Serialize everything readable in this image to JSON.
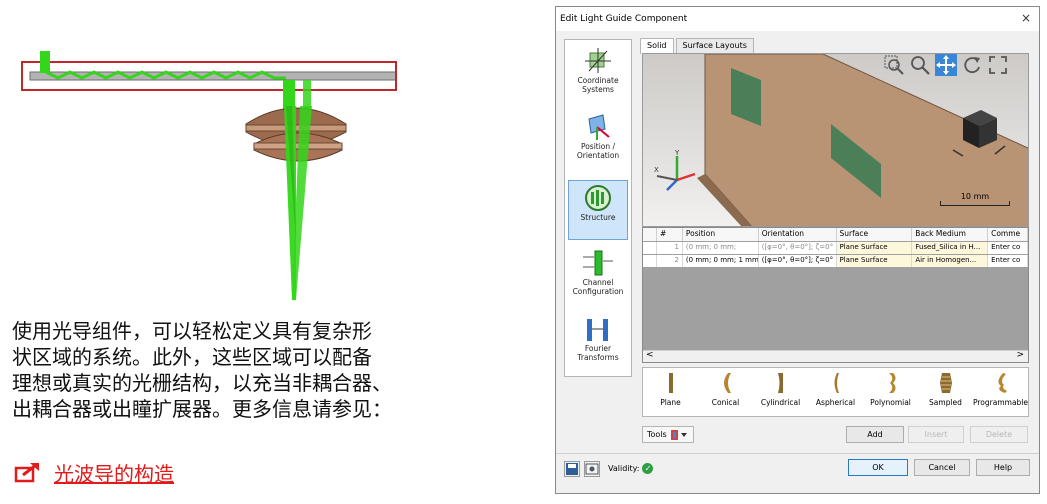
{
  "left_panel": {
    "description_lines": [
      "使用光导组件，可以轻松定义具有复杂形",
      "状区域的系统。此外，这些区域可以配备",
      "理想或真实的光栅结构，以充当非耦合器、",
      "出耦合器或出瞳扩展器。更多信息请参见："
    ],
    "link_text": "光波导的构造",
    "link_icon": "external-link-icon",
    "colors": {
      "beam": "#33d61a",
      "frame": "#c0272d",
      "link": "#e21a1a"
    }
  },
  "dialog": {
    "title": "Edit Light Guide Component",
    "close_glyph": "×",
    "nav": [
      {
        "label": "Coordinate Systems",
        "icon": "coordinate-systems-icon",
        "selected": false
      },
      {
        "label": "Position / Orientation",
        "icon": "position-orientation-icon",
        "selected": false
      },
      {
        "label": "Structure",
        "icon": "structure-icon",
        "selected": true
      },
      {
        "label": "Channel Configuration",
        "icon": "channel-configuration-icon",
        "selected": false
      },
      {
        "label": "Fourier Transforms",
        "icon": "fourier-transforms-icon",
        "selected": false
      }
    ],
    "tabs": [
      {
        "label": "Solid",
        "active": true
      },
      {
        "label": "Surface Layouts",
        "active": false
      }
    ],
    "viewport": {
      "tools": [
        "zoom-window-icon",
        "zoom-icon",
        "pan-icon",
        "rotate-icon",
        "fit-view-icon"
      ],
      "scale_label": "10 mm",
      "axis_labels": {
        "x": "X",
        "y": "Y"
      }
    },
    "table": {
      "headers": [
        "#",
        "Position",
        "Orientation",
        "Surface",
        "Back Medium",
        "Comme"
      ],
      "rows": [
        {
          "n": "1",
          "position": "(0 mm; 0 mm;",
          "orientation": "([φ=0°, θ=0°]; ζ=0°",
          "surface": "Plane Surface",
          "back_medium": "Fused_Silica in H...",
          "comment": "Enter co"
        },
        {
          "n": "2",
          "position": "(0 mm; 0 mm; 1 mm",
          "orientation": "([φ=0°, θ=0°]; ζ=0°",
          "surface": "Plane Surface",
          "back_medium": "Air in Homogen...",
          "comment": "Enter co"
        }
      ],
      "scroll_left": "<",
      "scroll_right": ">"
    },
    "surface_types": [
      "Plane",
      "Conical",
      "Cylindrical",
      "Aspherical",
      "Polynomial",
      "Sampled",
      "Programmable"
    ],
    "tools_label": "Tools",
    "buttons": {
      "add": "Add",
      "insert": "Insert",
      "delete": "Delete",
      "ok": "OK",
      "cancel": "Cancel",
      "help": "Help"
    },
    "validity_label": "Validity:",
    "validity_icon": "check-ok-icon"
  }
}
